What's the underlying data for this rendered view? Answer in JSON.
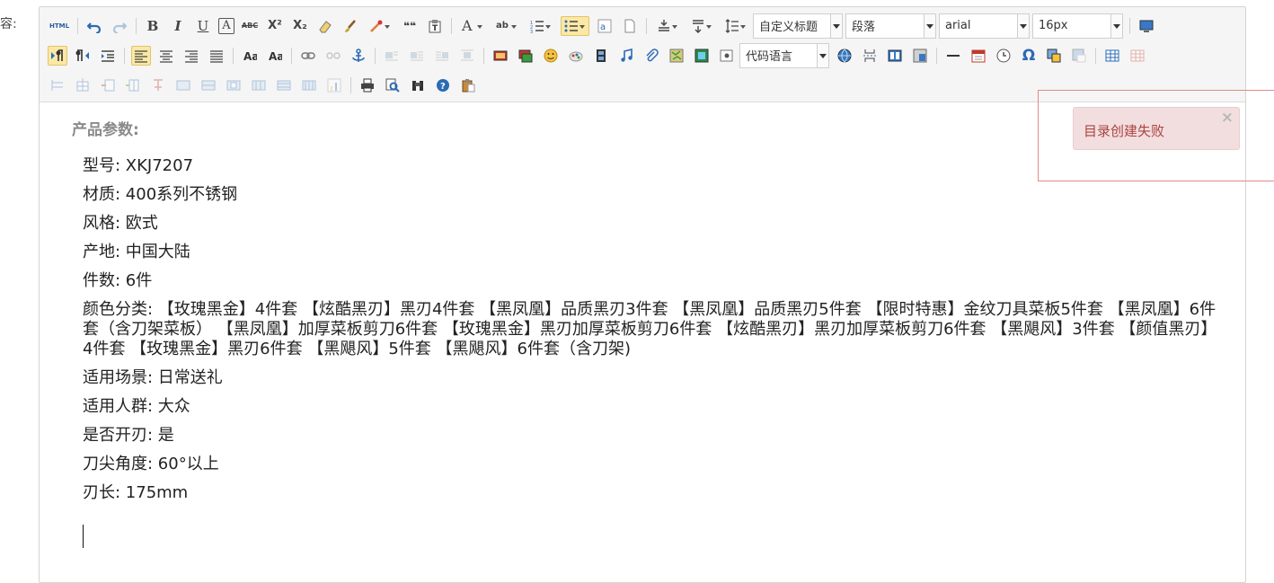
{
  "field_label": "容:",
  "toolbar": {
    "source_label": "HTML",
    "bold": "B",
    "italic": "I",
    "underline": "U",
    "text_border": "A",
    "strike": "ABC",
    "superscript": "X²",
    "subscript": "X₂",
    "blockquote": "❝❝",
    "font_color": "A",
    "highlight": "ab",
    "heading_select": "自定义标题",
    "paragraph_select": "段落",
    "font_family_select": "arial",
    "font_size_select": "16px",
    "code_language_select": "代码语言",
    "omega": "Ω"
  },
  "content": {
    "heading": "产品参数:",
    "params": [
      "型号: XKJ7207",
      "材质: 400系列不锈钢",
      "风格: 欧式",
      "产地: 中国大陆",
      "件数: 6件",
      "颜色分类: 【玫瑰黑金】4件套 【炫酷黑刃】黑刃4件套 【黑凤凰】品质黑刃3件套 【黑凤凰】品质黑刃5件套 【限时特惠】金纹刀具菜板5件套 【黑凤凰】6件套（含刀架菜板） 【黑凤凰】加厚菜板剪刀6件套 【玫瑰黑金】黑刃加厚菜板剪刀6件套 【炫酷黑刃】黑刃加厚菜板剪刀6件套 【黑飓风】3件套 【颜值黑刃】4件套 【玫瑰黑金】黑刃6件套 【黑飓风】5件套 【黑飓风】6件套（含刀架)",
      "适用场景: 日常送礼",
      "适用人群: 大众",
      "是否开刃: 是",
      "刀尖角度: 60°以上",
      "刃长: 175mm"
    ]
  },
  "notification": {
    "message": "目录创建失败",
    "close": "×"
  }
}
